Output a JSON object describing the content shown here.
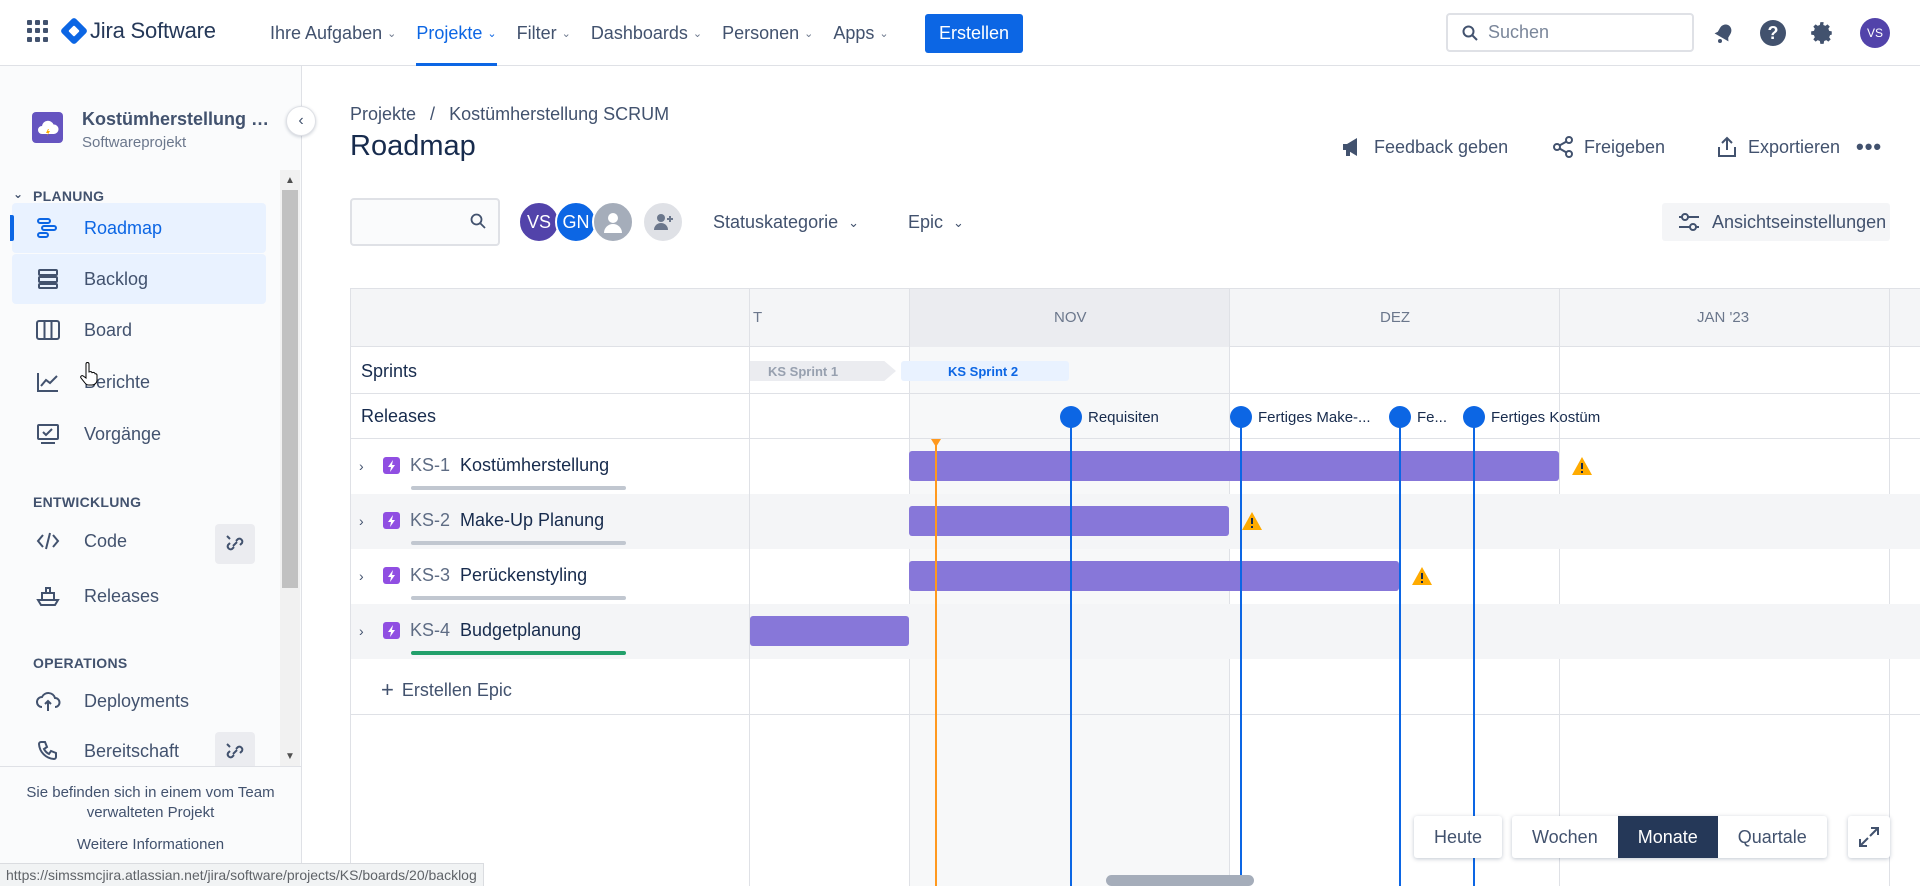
{
  "topnav": {
    "product": "Jira Software",
    "menu": [
      {
        "label": "Ihre Aufgaben",
        "active": false
      },
      {
        "label": "Projekte",
        "active": true
      },
      {
        "label": "Filter",
        "active": false
      },
      {
        "label": "Dashboards",
        "active": false
      },
      {
        "label": "Personen",
        "active": false
      },
      {
        "label": "Apps",
        "active": false
      }
    ],
    "create_label": "Erstellen",
    "search_placeholder": "Suchen",
    "avatar_initials": "VS"
  },
  "sidebar": {
    "project_name": "Kostümherstellung SC...",
    "project_type": "Softwareprojekt",
    "sections": {
      "planning": "PLANUNG",
      "development": "ENTWICKLUNG",
      "operations": "OPERATIONS"
    },
    "items": {
      "roadmap": "Roadmap",
      "backlog": "Backlog",
      "board": "Board",
      "reports": "Berichte",
      "issues": "Vorgänge",
      "code": "Code",
      "releases": "Releases",
      "deployments": "Deployments",
      "oncall": "Bereitschaft"
    },
    "footer_message": "Sie befinden sich in einem vom Team verwalteten Projekt",
    "footer_link": "Weitere Informationen"
  },
  "main": {
    "breadcrumb": [
      "Projekte",
      "/",
      "Kostümherstellung SCRUM"
    ],
    "title": "Roadmap",
    "actions": {
      "feedback": "Feedback geben",
      "share": "Freigeben",
      "export": "Exportieren"
    },
    "avatars": [
      {
        "initials": "VS",
        "color": "#5243aa"
      },
      {
        "initials": "GN",
        "color": "#0c66e4"
      }
    ],
    "filters": {
      "status_category": "Statuskategorie",
      "epic": "Epic",
      "view_settings": "Ansichtseinstellungen"
    }
  },
  "timeline": {
    "months": [
      "T",
      "NOV",
      "DEZ",
      "JAN '23"
    ],
    "rows": {
      "sprints": "Sprints",
      "releases": "Releases"
    },
    "sprints": [
      "KS Sprint 1",
      "KS Sprint 2"
    ],
    "releases": [
      "Requisiten",
      "Fertiges Make-...",
      "Fe...",
      "Fertiges Kostüm"
    ],
    "epics": [
      {
        "key": "KS-1",
        "name": "Kostümherstellung",
        "warning": true,
        "progress_done": false
      },
      {
        "key": "KS-2",
        "name": "Make-Up Planung",
        "warning": true,
        "progress_done": false
      },
      {
        "key": "KS-3",
        "name": "Perückenstyling",
        "warning": true,
        "progress_done": false
      },
      {
        "key": "KS-4",
        "name": "Budgetplanung",
        "warning": false,
        "progress_done": true
      }
    ],
    "create_epic": "Erstellen Epic"
  },
  "controls": {
    "today": "Heute",
    "weeks": "Wochen",
    "months": "Monate",
    "quarters": "Quartale",
    "active": "Monate"
  },
  "status_url": "https://simssmcjira.atlassian.net/jira/software/projects/KS/boards/20/backlog"
}
